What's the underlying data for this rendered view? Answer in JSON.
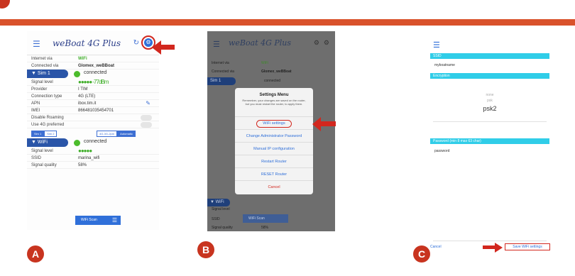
{
  "panelA": {
    "brand": "weBoat 4G Plus",
    "rows_top": [
      {
        "label": "Internet via",
        "value": "WiFi"
      },
      {
        "label": "Connected via",
        "value": "Glomex_weBBoat"
      }
    ],
    "sim1": {
      "label": "Sim 1",
      "status": "connected",
      "rows": [
        {
          "label": "Signal level",
          "value": "●●●●● -77dBm"
        },
        {
          "label": "Provider",
          "value": "I TIM"
        },
        {
          "label": "Connection type",
          "value": "4G (LTE)"
        },
        {
          "label": "APN",
          "value": "ibox.tim.it"
        },
        {
          "label": "IMEI",
          "value": "866481035454701"
        },
        {
          "label": "Disable Roaming",
          "value": ""
        },
        {
          "label": "Use 4G preferred",
          "value": ""
        }
      ],
      "tabs": [
        "Sim 1",
        "Sim 2"
      ],
      "tabs_right": [
        "4G-3G-2pm",
        "Automatic"
      ]
    },
    "wifi": {
      "label": "WiFi",
      "status": "connected",
      "rows": [
        {
          "label": "Signal level",
          "value": "●●●●●"
        },
        {
          "label": "SSID",
          "value": "marina_wifi"
        },
        {
          "label": "Signal quality",
          "value": "58%"
        }
      ],
      "scan_label": "WiFi Scan"
    }
  },
  "panelB": {
    "brand": "weBoat 4G Plus",
    "bg_rows": [
      {
        "label": "Internet via",
        "value": "WiFi"
      },
      {
        "label": "Connected via",
        "value": "Glomex_weBBoat"
      },
      {
        "label": "Sim 1",
        "value": "connected"
      }
    ],
    "bottom_rows": [
      {
        "label": "Signal level",
        "value": ""
      },
      {
        "label": "SSID",
        "value": ""
      },
      {
        "label": "Signal quality",
        "value": "58%"
      }
    ],
    "menu": {
      "title": "Settings Menu",
      "note": "Remember, your changes are saved on the router, but you must restart the router, to apply them.",
      "items": [
        "WiFi settings",
        "Change Administrator Password",
        "Manual IP configuration",
        "Restart Router",
        "RESET Router",
        "Cancel"
      ]
    },
    "scan_label": "WiFi Scan"
  },
  "panelC": {
    "ssid_header": "SSID",
    "ssid_value": "myboatname",
    "encryption_header": "Encryption",
    "enc_above": "none",
    "enc_above2": "psk",
    "enc_selected": "psk2",
    "password_header": "Password (min 8 max 63 char)",
    "password_value": "password",
    "cancel_label": "Cancel",
    "save_label": "Save WiFi settings"
  },
  "badges": [
    "A",
    "B",
    "C"
  ],
  "colors": {
    "accent_red": "#d2271e",
    "rule_orange": "#d9522b",
    "ios_blue": "#2f6fd9",
    "cyan": "#30cde8",
    "green": "#4cbc2c"
  }
}
